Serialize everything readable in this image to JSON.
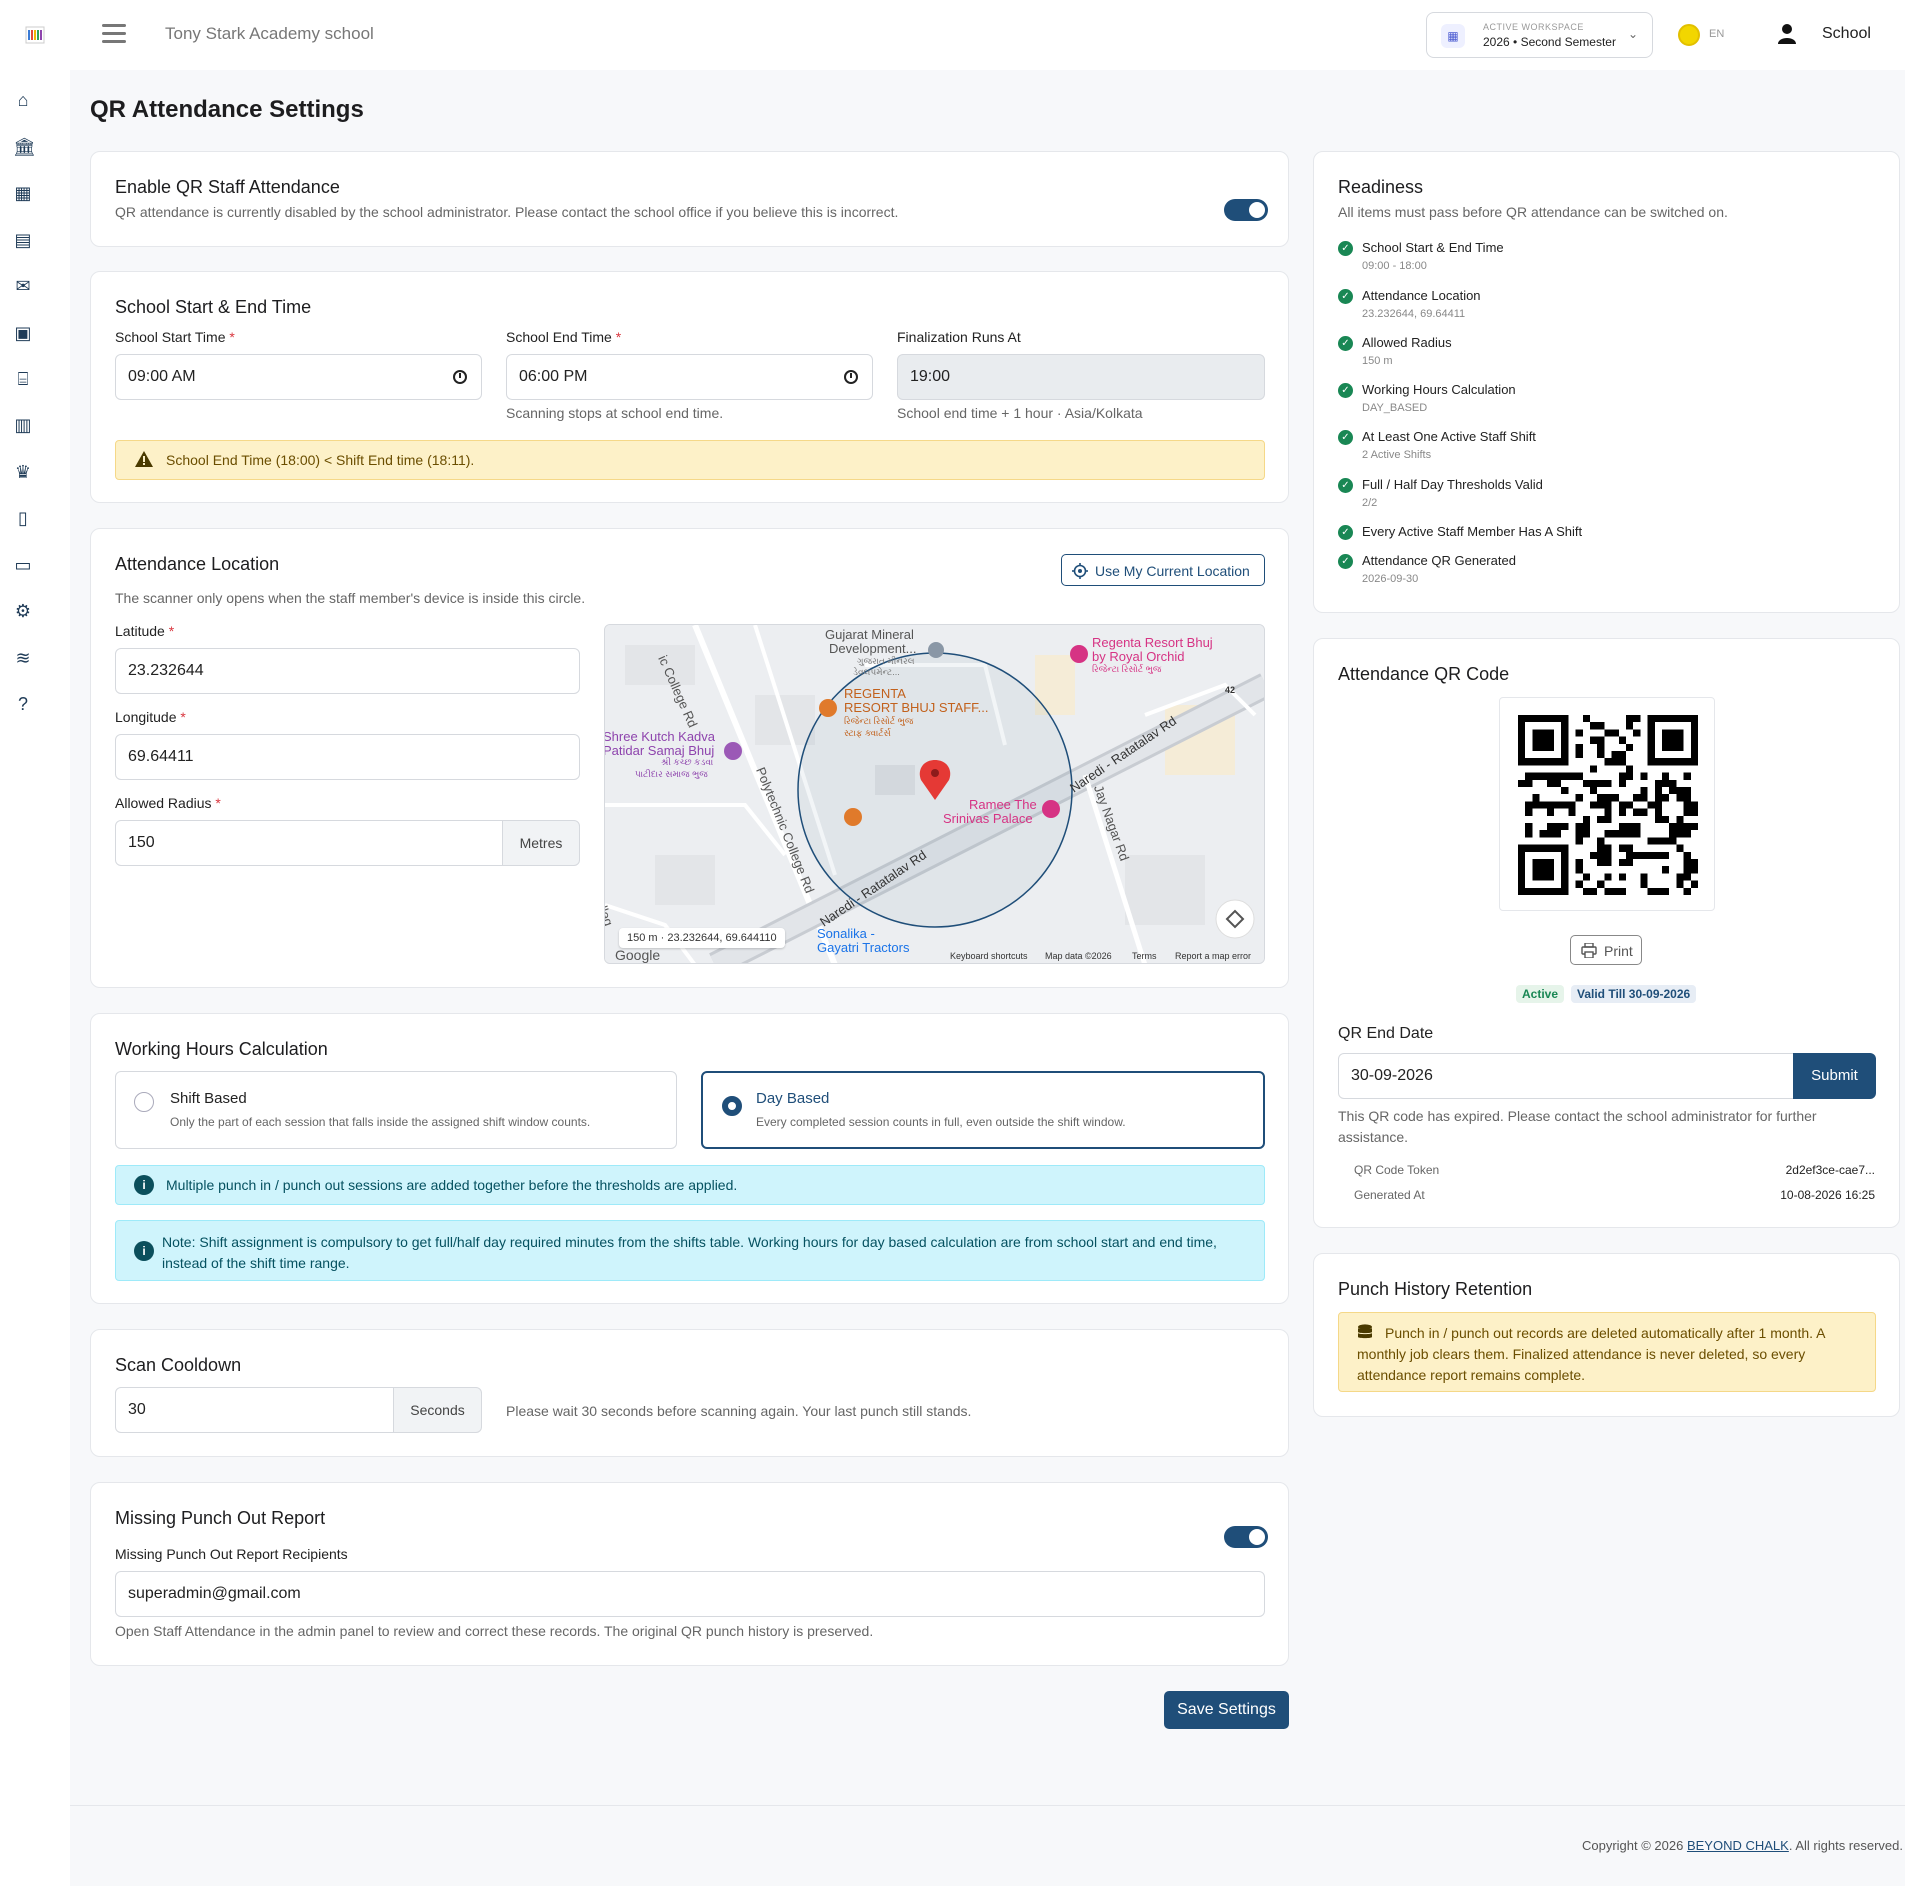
{
  "header": {
    "school_name": "Tony Stark Academy school",
    "workspace_label": "ACTIVE WORKSPACE",
    "workspace_value": "2026 • Second Semester",
    "language": "EN",
    "user_name": "School"
  },
  "page": {
    "title": "QR Attendance Settings"
  },
  "enable_qr": {
    "title": "Enable QR Staff Attendance",
    "description": "QR attendance is currently disabled by the school administrator. Please contact the school office if you believe this is incorrect.",
    "enabled": true
  },
  "school_time": {
    "title": "School Start & End Time",
    "start_label": "School Start Time",
    "start_value": "09:00 AM",
    "end_label": "School End Time",
    "end_value": "06:00 PM",
    "end_help": "Scanning stops at school end time.",
    "finalization_label": "Finalization Runs At",
    "finalization_value": "19:00",
    "finalization_help": "School end time + 1 hour · Asia/Kolkata",
    "warning": "School End Time (18:00) < Shift End time (18:11).",
    "required_mark": "*"
  },
  "location": {
    "title": "Attendance Location",
    "description": "The scanner only opens when the staff member's device is inside this circle.",
    "use_location_button": "Use My Current Location",
    "latitude_label": "Latitude",
    "latitude_value": "23.232644",
    "longitude_label": "Longitude",
    "longitude_value": "69.64411",
    "radius_label": "Allowed Radius",
    "radius_value": "150",
    "radius_unit": "Metres",
    "map": {
      "readout": "150 m · 23.232644, 69.644110",
      "labels": {
        "gujarat_mineral": "Gujarat Mineral",
        "development": "Development...",
        "gujarat_mineral_gu1": "ગુજરાત મીનરલ",
        "gujarat_mineral_gu2": "ડેવલપમેન્ટ...",
        "regenta_staff1": "REGENTA",
        "regenta_staff2": "RESORT BHUJ STAFF...",
        "regenta_staff_gu1": "રિજેન્ટા રિસોર્ટ ભુજ",
        "regenta_staff_gu2": "સ્ટાફ ક્વાર્ટર્સ",
        "regenta_resort1": "Regenta Resort Bhuj",
        "regenta_resort2": "by Royal Orchid",
        "regenta_resort_gu": "રિજેન્ટા રિસોર્ટ ભુજ",
        "shree_kutch1": "Shree Kutch Kadva",
        "shree_kutch2": "Patidar Samaj Bhuj",
        "shree_kutch_gu1": "શ્રી કચ્છ કડવા",
        "shree_kutch_gu2": "પાટીદાર સમાજ ભુજ",
        "college_rd": "ic College Rd",
        "polytechnic_rd": "Polytechnic College Rd",
        "naredi_rd1": "Naredi - Ratatalav Rd",
        "naredi_rd2": "Naredi - Ratatalav Rd",
        "jay_nagar": "Jay Nagar Rd",
        "ramee1": "Ramee The",
        "ramee2": "Srinivas Palace",
        "sonalika1": "Sonalika -",
        "sonalika2": "Gayatri Tractors",
        "road_42": "42",
        "colleg": "olleg",
        "google": "Google",
        "keyboard": "Keyboard shortcuts",
        "map_data": "Map data ©2026",
        "terms": "Terms",
        "report": "Report a map error"
      }
    }
  },
  "working_hours": {
    "title": "Working Hours Calculation",
    "options": [
      {
        "title": "Shift Based",
        "description": "Only the part of each session that falls inside the assigned shift window counts.",
        "selected": false
      },
      {
        "title": "Day Based",
        "description": "Every completed session counts in full, even outside the shift window.",
        "selected": true
      }
    ],
    "info1": "Multiple punch in / punch out sessions are added together before the thresholds are applied.",
    "info2": "Note: Shift assignment is compulsory to get full/half day required minutes from the shifts table. Working hours for day based calculation are from school start and end time, instead of the shift time range."
  },
  "cooldown": {
    "title": "Scan Cooldown",
    "value": "30",
    "unit": "Seconds",
    "help": "Please wait 30 seconds before scanning again. Your last punch still stands."
  },
  "missing_punch": {
    "title": "Missing Punch Out Report",
    "enabled": true,
    "recipients_label": "Missing Punch Out Report Recipients",
    "recipients_value": "superadmin@gmail.com",
    "help": "Open Staff Attendance in the admin panel to review and correct these records. The original QR punch history is preserved."
  },
  "save_button": "Save Settings",
  "readiness": {
    "title": "Readiness",
    "subtitle": "All items must pass before QR attendance can be switched on.",
    "items": [
      {
        "title": "School Start & End Time",
        "sub": "09:00 - 18:00"
      },
      {
        "title": "Attendance Location",
        "sub": "23.232644, 69.64411"
      },
      {
        "title": "Allowed Radius",
        "sub": "150 m"
      },
      {
        "title": "Working Hours Calculation",
        "sub": "DAY_BASED"
      },
      {
        "title": "At Least One Active Staff Shift",
        "sub": "2 Active Shifts"
      },
      {
        "title": "Full / Half Day Thresholds Valid",
        "sub": "2/2"
      },
      {
        "title": "Every Active Staff Member Has A Shift",
        "sub": ""
      },
      {
        "title": "Attendance QR Generated",
        "sub": "2026-09-30"
      }
    ]
  },
  "qr": {
    "title": "Attendance QR Code",
    "print_button": "Print",
    "status_badge": "Active",
    "valid_badge": "Valid Till 30-09-2026",
    "end_date_label": "QR End Date",
    "end_date_value": "30-09-2026",
    "submit_button": "Submit",
    "expired_message": "This QR code has expired. Please contact the school administrator for further assistance.",
    "token_label": "QR Code Token",
    "token_value": "2d2ef3ce-cae7...",
    "generated_label": "Generated At",
    "generated_value": "10-08-2026 16:25"
  },
  "retention": {
    "title": "Punch History Retention",
    "message": "Punch in / punch out records are deleted automatically after 1 month. A monthly job clears them. Finalized attendance is never deleted, so every attendance report remains complete."
  },
  "footer": {
    "copyright_prefix": "Copyright © 2026",
    "brand": "BEYOND CHALK",
    "copyright_suffix": ". All rights reserved."
  },
  "colors": {
    "primary": "#1f4e79",
    "success": "#198754",
    "warning_bg": "#fdf1c8",
    "info_bg": "#cff4fc"
  }
}
